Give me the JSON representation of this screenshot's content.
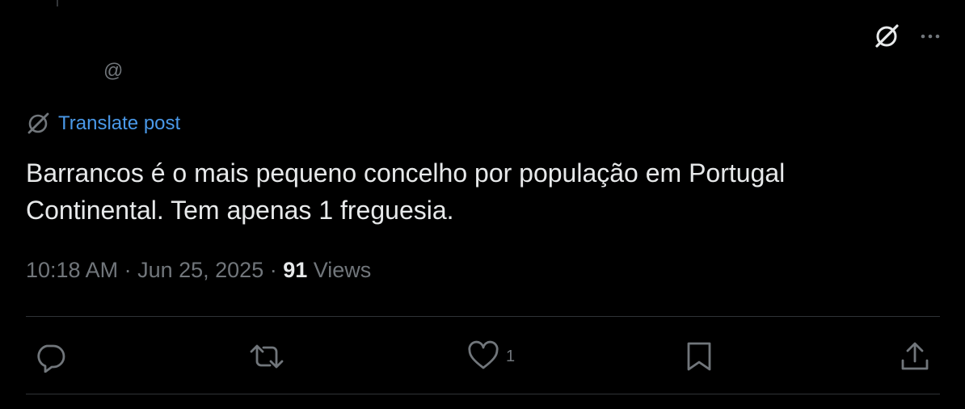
{
  "post": {
    "handle": "@",
    "translate_label": "Translate post",
    "text": "Barrancos é o mais pequeno concelho por população em Portugal\nContinental. Tem apenas 1 freguesia.",
    "time": "10:18 AM",
    "separator": " · ",
    "date": "Jun 25, 2025",
    "views_count": "91",
    "views_label": " Views"
  },
  "actions": {
    "reply_count": "",
    "repost_count": "",
    "like_count": "1"
  },
  "icons": {
    "top": [
      "grok-icon",
      "more-icon"
    ],
    "translate": "translate-icon",
    "actions": [
      "reply-icon",
      "repost-icon",
      "like-icon",
      "bookmark-icon",
      "share-icon"
    ]
  },
  "colors": {
    "background": "#000000",
    "text": "#e7e9ea",
    "secondary": "#71767b",
    "link": "#4a99e9",
    "divider": "#2f3336"
  }
}
